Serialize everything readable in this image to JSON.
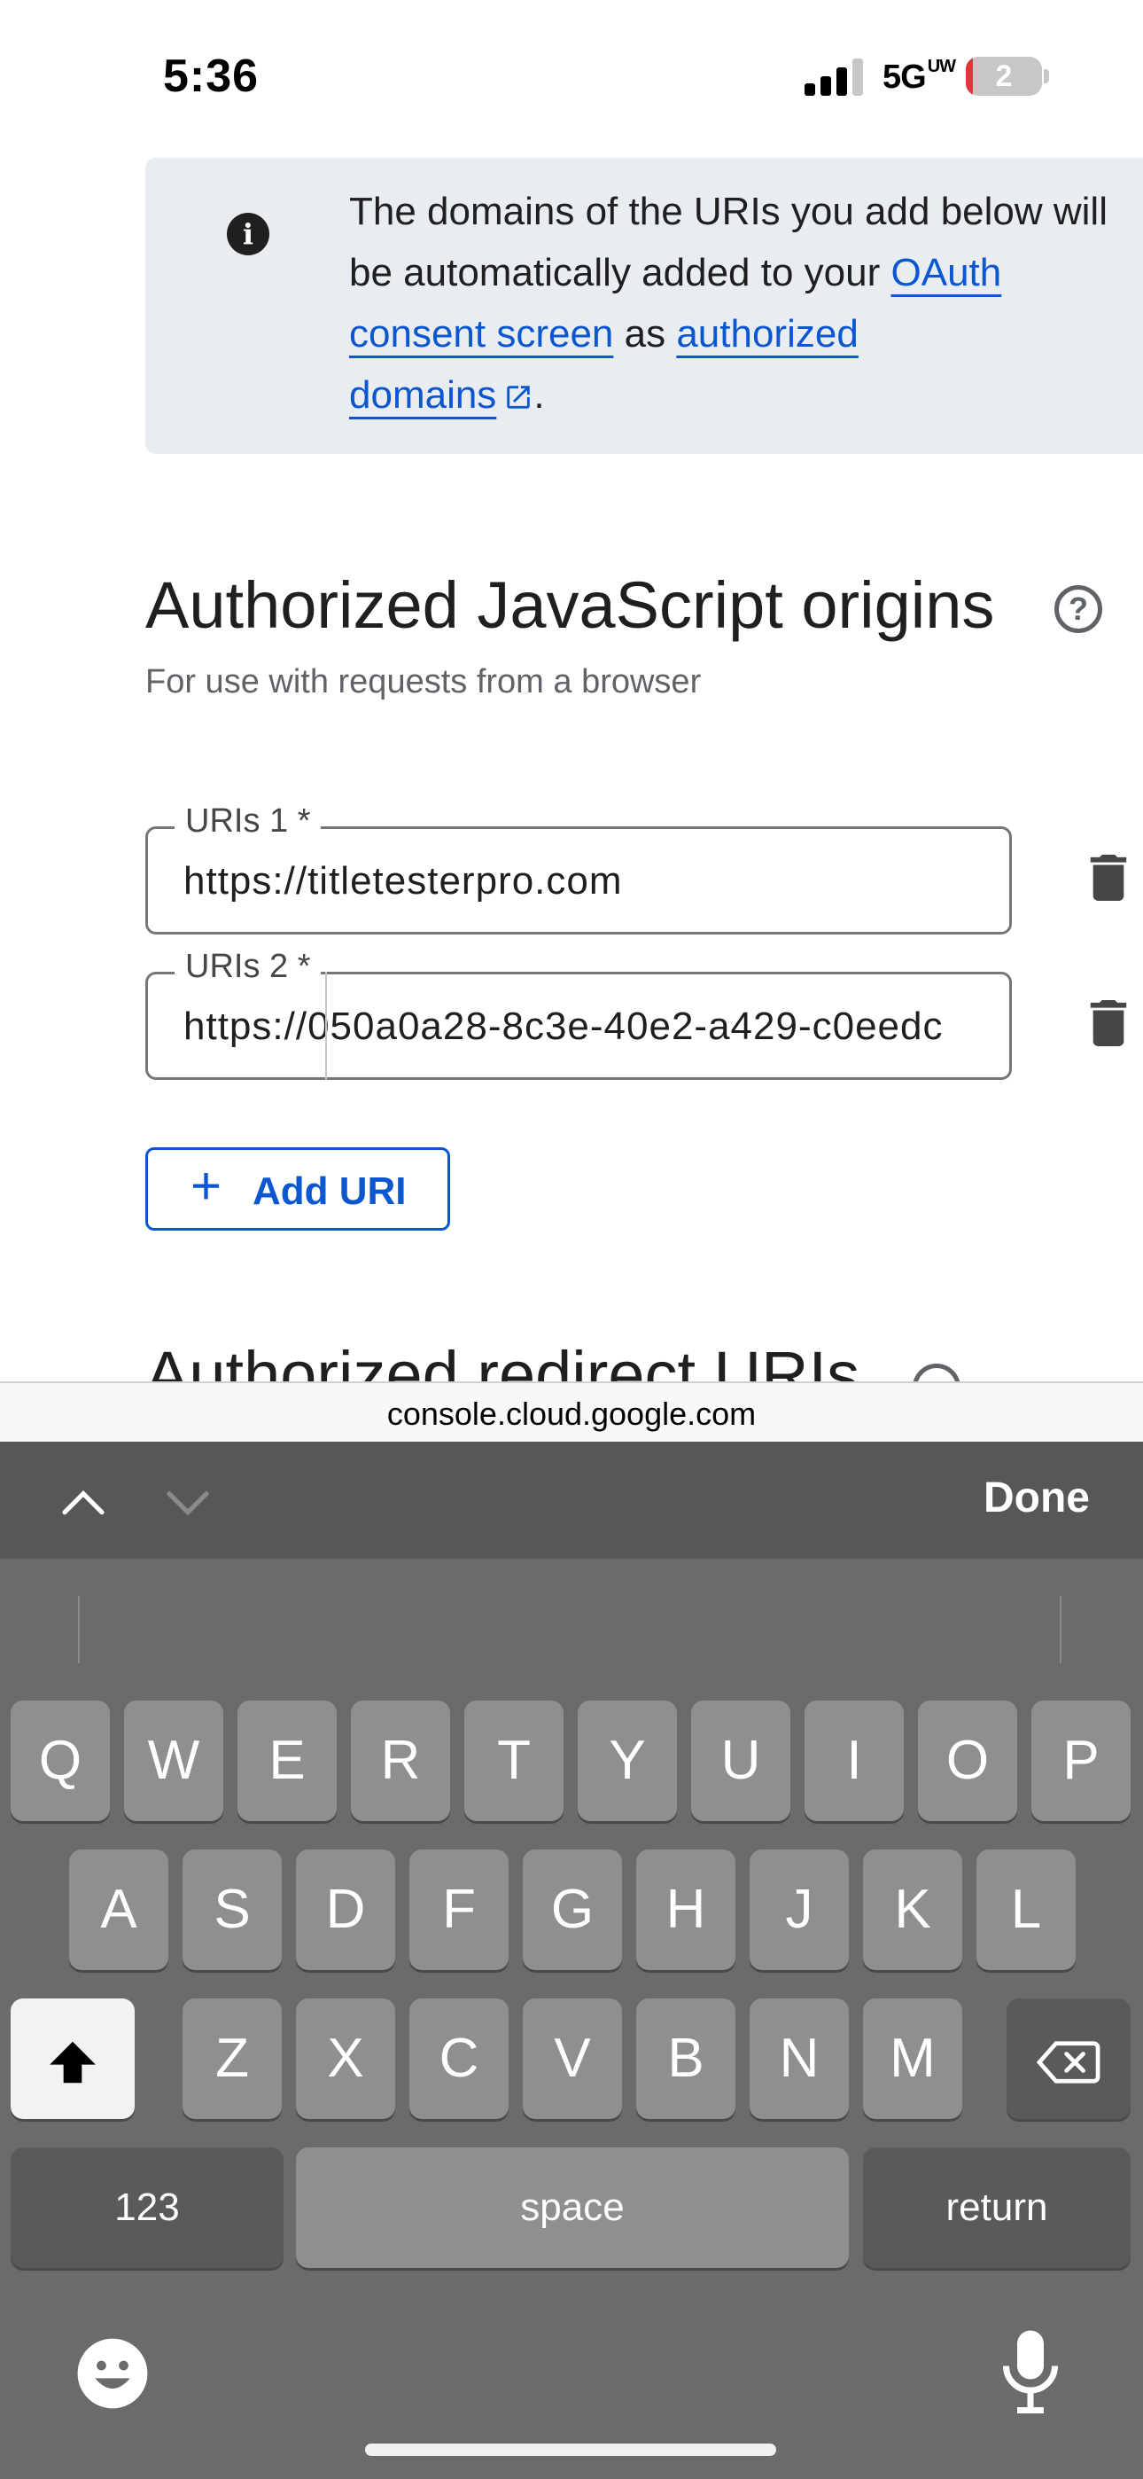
{
  "status_bar": {
    "time": "5:36",
    "network": "5G",
    "network_sub": "UW",
    "battery": "2"
  },
  "info_banner": {
    "text_1": "The domains of the URIs you add below will be automatically added to your ",
    "link_consent": "OAuth consent screen",
    "text_2": " as ",
    "link_domains_1": "authorized",
    "link_domains_2": "domains",
    "text_3": "."
  },
  "section": {
    "title": "Authorized JavaScript origins",
    "subtitle": "For use with requests from a browser",
    "help": "?"
  },
  "uris": [
    {
      "label": "URIs 1 *",
      "value": "https://titletesterpro.com"
    },
    {
      "label": "URIs 2 *",
      "value": "https://050a0a28-8c3e-40e2-a429-c0eedc"
    }
  ],
  "add_uri_label": "Add URI",
  "next_section_title": "Authorized redirect URIs",
  "url_bar": {
    "domain": "console.cloud.google.com"
  },
  "kb_toolbar": {
    "done_label": "Done"
  },
  "keyboard": {
    "row1": [
      "Q",
      "W",
      "E",
      "R",
      "T",
      "Y",
      "U",
      "I",
      "O",
      "P"
    ],
    "row2": [
      "A",
      "S",
      "D",
      "F",
      "G",
      "H",
      "J",
      "K",
      "L"
    ],
    "row3": [
      "Z",
      "X",
      "C",
      "V",
      "B",
      "N",
      "M"
    ],
    "numbers_label": "123",
    "space_label": "space",
    "return_label": "return"
  },
  "colors": {
    "accent": "#0b57d0",
    "banner_bg": "#e9edf1",
    "keyboard_bg": "#6b6b6b"
  }
}
